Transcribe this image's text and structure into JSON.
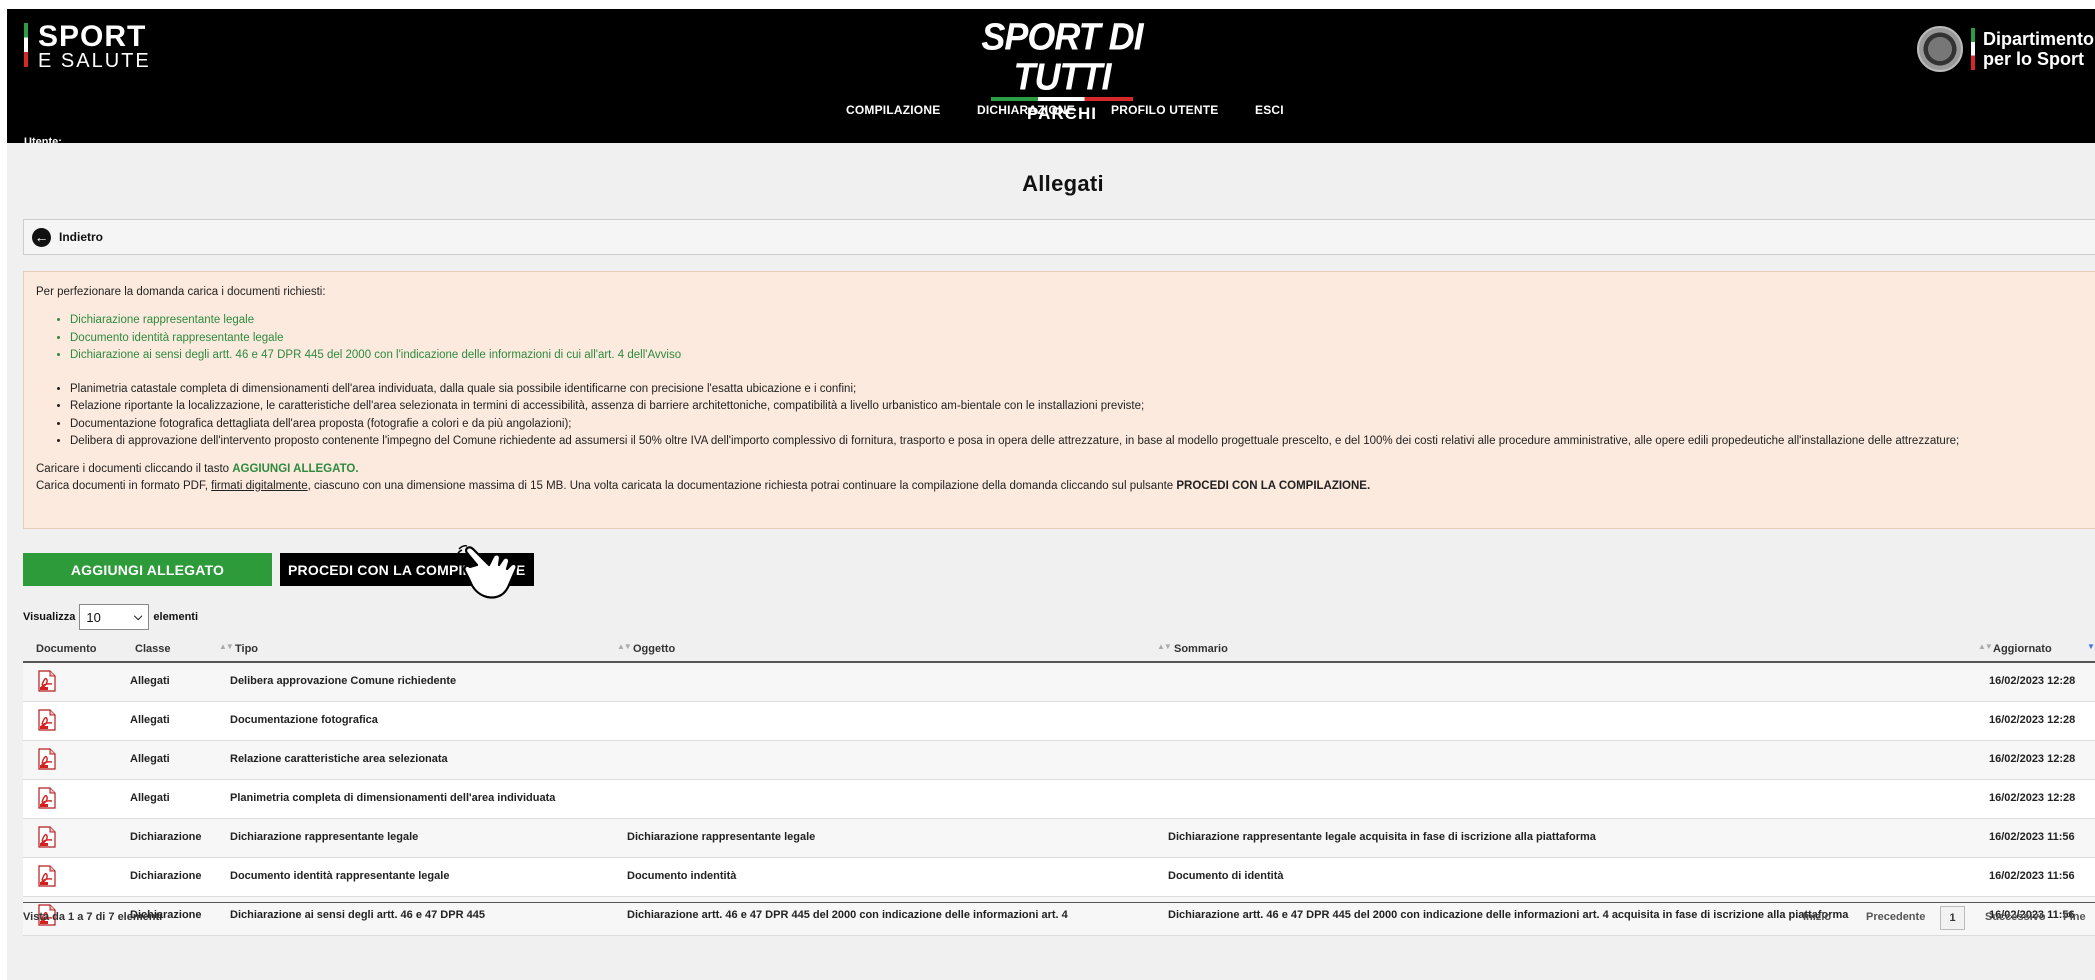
{
  "header": {
    "brand_left_line1": "SPORT",
    "brand_left_line2": "E SALUTE",
    "brand_center_line1": "SPORT DI TUTTI",
    "brand_center_line2": "PARCHI",
    "brand_right_line1": "Dipartimento",
    "brand_right_line2": "per lo Sport",
    "nav": [
      "COMPILAZIONE",
      "DICHIARAZIONE",
      "PROFILO UTENTE",
      "ESCI"
    ],
    "user_label": "Utente:"
  },
  "page": {
    "title": "Allegati",
    "back_label": "Indietro"
  },
  "info": {
    "intro": "Per perfezionare la domanda carica i documenti richiesti:",
    "green_items": [
      "Dichiarazione rappresentante legale",
      "Documento identità rappresentante legale",
      "Dichiarazione ai sensi degli artt. 46 e 47 DPR 445 del 2000 con l'indicazione delle informazioni di cui all'art. 4 dell'Avviso"
    ],
    "plain_items": [
      "Planimetria catastale completa di dimensionamenti dell'area individuata, dalla quale sia possibile identificarne con precisione l'esatta ubicazione e i confini;",
      "Relazione riportante la localizzazione, le caratteristiche dell'area selezionata in termini di accessibilità, assenza di barriere architettoniche, compatibilità a livello urbanistico am-bientale con le installazioni previste;",
      "Documentazione fotografica dettagliata dell'area proposta (fotografie a colori e da più angolazioni);",
      "Delibera di approvazione dell'intervento proposto contenente l'impegno del Comune richiedente ad assumersi il 50% oltre IVA dell'importo complessivo di fornitura, trasporto e posa in opera delle attrezzature, in base al modello progettuale prescelto, e del 100% dei costi relativi alle procedure amministrative, alle opere edili propedeutiche all'installazione delle attrezzature;"
    ],
    "upload_prefix": "Caricare i documenti cliccando il tasto ",
    "upload_action": "AGGIUNGI ALLEGATO.",
    "format_prefix": "Carica documenti in formato PDF, ",
    "format_link": "firmati digitalmente",
    "format_mid": ", ciascuno con una dimensione massima di 15 MB. Una volta caricata la documentazione richiesta potrai continuare la compilazione della domanda cliccando sul pulsante ",
    "format_action": "PROCEDI CON LA COMPILAZIONE."
  },
  "buttons": {
    "add": "AGGIUNGI ALLEGATO",
    "proceed": "PROCEDI CON LA COMPILAZIONE"
  },
  "length_menu": {
    "prefix": "Visualizza",
    "value": "10",
    "suffix": "elementi"
  },
  "table": {
    "headers": [
      "Documento",
      "Classe",
      "Tipo",
      "Oggetto",
      "Sommario",
      "Aggiornato"
    ],
    "rows": [
      {
        "classe": "Allegati",
        "tipo": "Delibera approvazione Comune richiedente",
        "oggetto": "",
        "sommario": "",
        "aggiornato": "16/02/2023 12:28"
      },
      {
        "classe": "Allegati",
        "tipo": "Documentazione fotografica",
        "oggetto": "",
        "sommario": "",
        "aggiornato": "16/02/2023 12:28"
      },
      {
        "classe": "Allegati",
        "tipo": "Relazione caratteristiche area selezionata",
        "oggetto": "",
        "sommario": "",
        "aggiornato": "16/02/2023 12:28"
      },
      {
        "classe": "Allegati",
        "tipo": "Planimetria completa di dimensionamenti dell'area individuata",
        "oggetto": "",
        "sommario": "",
        "aggiornato": "16/02/2023 12:28"
      },
      {
        "classe": "Dichiarazione",
        "tipo": "Dichiarazione rappresentante legale",
        "oggetto": "Dichiarazione rappresentante legale",
        "sommario": "Dichiarazione rappresentante legale acquisita in fase di iscrizione alla piattaforma",
        "aggiornato": "16/02/2023 11:56"
      },
      {
        "classe": "Dichiarazione",
        "tipo": "Documento identità rappresentante legale",
        "oggetto": "Documento indentità",
        "sommario": "Documento di identità",
        "aggiornato": "16/02/2023 11:56"
      },
      {
        "classe": "Dichiarazione",
        "tipo": "Dichiarazione ai sensi degli artt. 46 e 47 DPR 445",
        "oggetto": "Dichiarazione artt. 46 e 47 DPR 445 del 2000 con indicazione delle informazioni art. 4",
        "sommario": "Dichiarazione artt. 46 e 47 DPR 445 del 2000 con indicazione delle informazioni art. 4 acquisita in fase di iscrizione alla piattaforma",
        "aggiornato": "16/02/2023 11:56"
      }
    ],
    "footer_info": "Vista da 1 a 7 di 7 elementi",
    "pagination": {
      "first": "Inizio",
      "prev": "Precedente",
      "current": "1",
      "next": "Successivo",
      "last": "Fine"
    }
  }
}
